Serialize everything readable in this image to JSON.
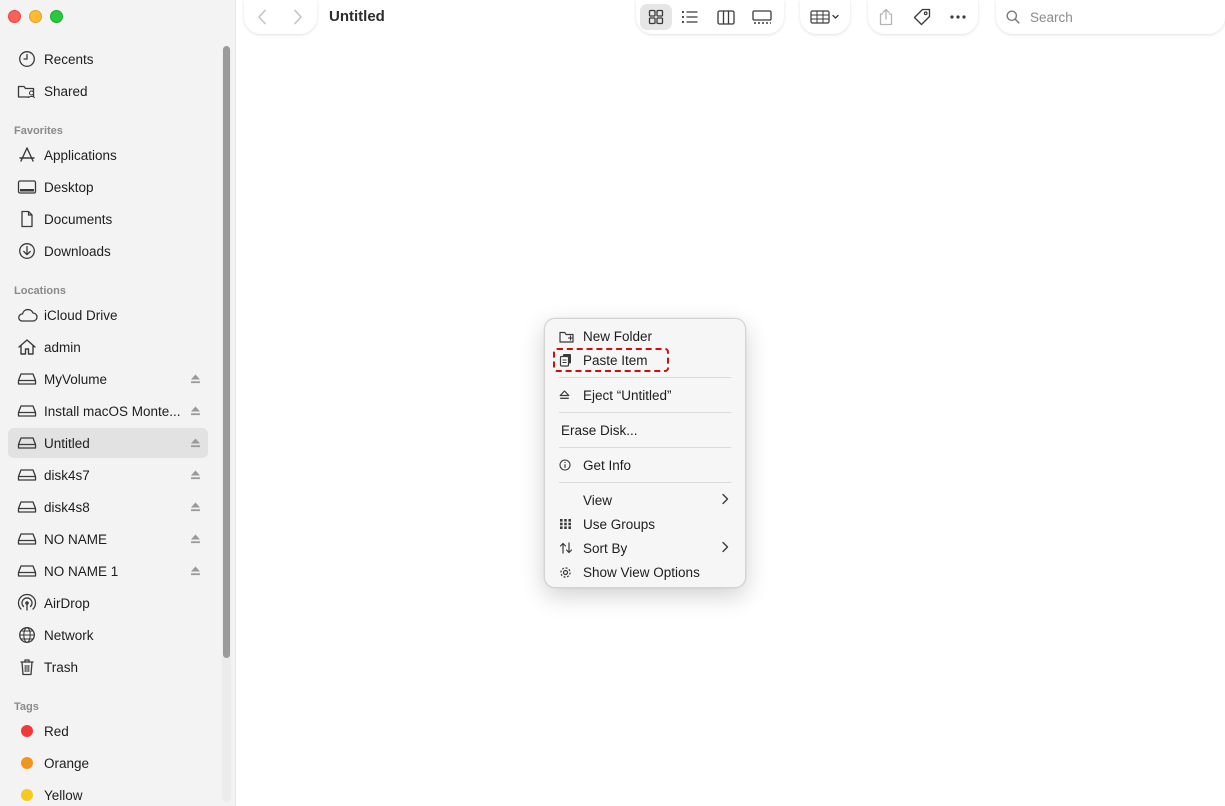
{
  "window": {
    "title": "Untitled"
  },
  "colors": {
    "close": "#ff5f57",
    "minimize": "#febc2e",
    "zoom": "#28c840",
    "accent": "#d10d0d"
  },
  "sidebar": {
    "top_items": [
      {
        "label": "Recents",
        "icon": "clock-icon"
      },
      {
        "label": "Shared",
        "icon": "shared-folder-icon"
      }
    ],
    "favorites_header": "Favorites",
    "favorites": [
      {
        "label": "Applications",
        "icon": "applications-icon"
      },
      {
        "label": "Desktop",
        "icon": "desktop-icon"
      },
      {
        "label": "Documents",
        "icon": "document-icon"
      },
      {
        "label": "Downloads",
        "icon": "download-icon"
      }
    ],
    "locations_header": "Locations",
    "locations": [
      {
        "label": "iCloud Drive",
        "icon": "cloud-icon"
      },
      {
        "label": "admin",
        "icon": "home-icon"
      },
      {
        "label": "MyVolume",
        "icon": "drive-icon",
        "eject": true
      },
      {
        "label": "Install macOS Monte...",
        "icon": "drive-icon",
        "eject": true
      },
      {
        "label": "Untitled",
        "icon": "drive-icon",
        "eject": true,
        "selected": true
      },
      {
        "label": "disk4s7",
        "icon": "drive-icon",
        "eject": true
      },
      {
        "label": "disk4s8",
        "icon": "drive-icon",
        "eject": true
      },
      {
        "label": "NO NAME",
        "icon": "drive-icon",
        "eject": true
      },
      {
        "label": "NO NAME 1",
        "icon": "drive-icon",
        "eject": true
      },
      {
        "label": "AirDrop",
        "icon": "airdrop-icon"
      },
      {
        "label": "Network",
        "icon": "network-icon"
      },
      {
        "label": "Trash",
        "icon": "trash-icon"
      }
    ],
    "tags_header": "Tags",
    "tags": [
      {
        "label": "Red",
        "color": "#ef3b36"
      },
      {
        "label": "Orange",
        "color": "#f5941d"
      },
      {
        "label": "Yellow",
        "color": "#f7c81e"
      }
    ]
  },
  "search": {
    "placeholder": "Search"
  },
  "context_menu": {
    "new_folder": "New Folder",
    "paste_item": "Paste Item",
    "eject": "Eject “Untitled”",
    "erase_disk": "Erase Disk...",
    "get_info": "Get Info",
    "view": "View",
    "use_groups": "Use Groups",
    "sort_by": "Sort By",
    "show_view_options": "Show View Options"
  }
}
